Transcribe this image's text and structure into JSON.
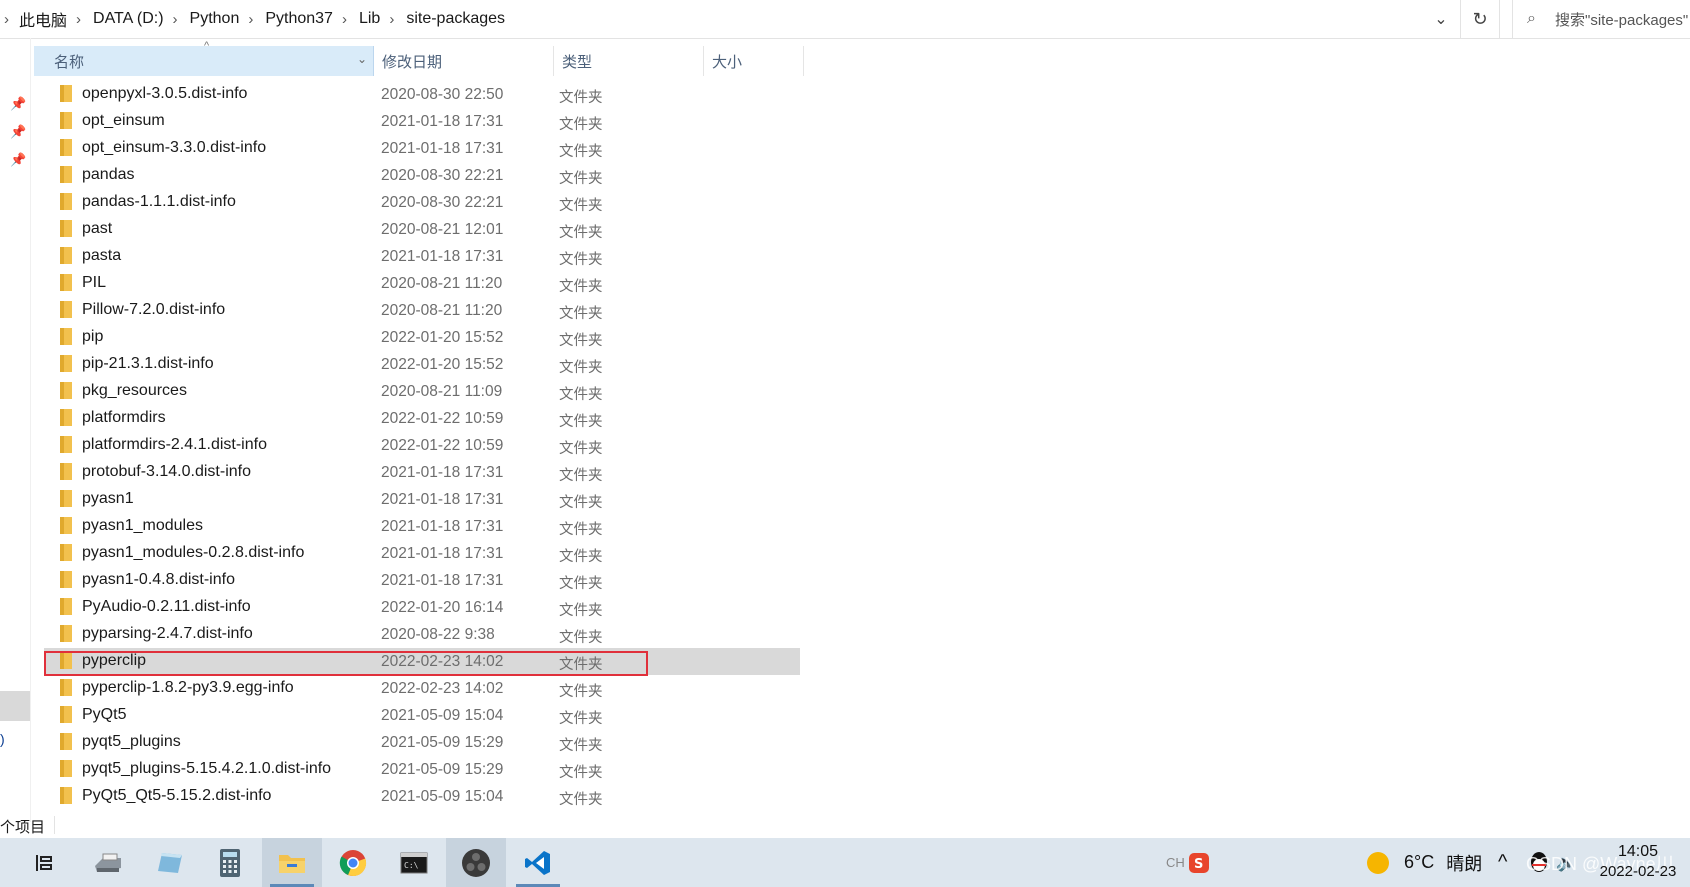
{
  "breadcrumb": {
    "items": [
      "此电脑",
      "DATA (D:)",
      "Python",
      "Python37",
      "Lib",
      "site-packages"
    ]
  },
  "search": {
    "placeholder": "搜索\"site-packages\""
  },
  "columns": {
    "name": "名称",
    "date": "修改日期",
    "type": "类型",
    "size": "大小"
  },
  "files": [
    {
      "name": "openpyxl-3.0.5.dist-info",
      "date": "2020-08-30 22:50",
      "type": "文件夹"
    },
    {
      "name": "opt_einsum",
      "date": "2021-01-18 17:31",
      "type": "文件夹"
    },
    {
      "name": "opt_einsum-3.3.0.dist-info",
      "date": "2021-01-18 17:31",
      "type": "文件夹"
    },
    {
      "name": "pandas",
      "date": "2020-08-30 22:21",
      "type": "文件夹"
    },
    {
      "name": "pandas-1.1.1.dist-info",
      "date": "2020-08-30 22:21",
      "type": "文件夹"
    },
    {
      "name": "past",
      "date": "2020-08-21 12:01",
      "type": "文件夹"
    },
    {
      "name": "pasta",
      "date": "2021-01-18 17:31",
      "type": "文件夹"
    },
    {
      "name": "PIL",
      "date": "2020-08-21 11:20",
      "type": "文件夹"
    },
    {
      "name": "Pillow-7.2.0.dist-info",
      "date": "2020-08-21 11:20",
      "type": "文件夹"
    },
    {
      "name": "pip",
      "date": "2022-01-20 15:52",
      "type": "文件夹"
    },
    {
      "name": "pip-21.3.1.dist-info",
      "date": "2022-01-20 15:52",
      "type": "文件夹"
    },
    {
      "name": "pkg_resources",
      "date": "2020-08-21 11:09",
      "type": "文件夹"
    },
    {
      "name": "platformdirs",
      "date": "2022-01-22 10:59",
      "type": "文件夹"
    },
    {
      "name": "platformdirs-2.4.1.dist-info",
      "date": "2022-01-22 10:59",
      "type": "文件夹"
    },
    {
      "name": "protobuf-3.14.0.dist-info",
      "date": "2021-01-18 17:31",
      "type": "文件夹"
    },
    {
      "name": "pyasn1",
      "date": "2021-01-18 17:31",
      "type": "文件夹"
    },
    {
      "name": "pyasn1_modules",
      "date": "2021-01-18 17:31",
      "type": "文件夹"
    },
    {
      "name": "pyasn1_modules-0.2.8.dist-info",
      "date": "2021-01-18 17:31",
      "type": "文件夹"
    },
    {
      "name": "pyasn1-0.4.8.dist-info",
      "date": "2021-01-18 17:31",
      "type": "文件夹"
    },
    {
      "name": "PyAudio-0.2.11.dist-info",
      "date": "2022-01-20 16:14",
      "type": "文件夹"
    },
    {
      "name": "pyparsing-2.4.7.dist-info",
      "date": "2020-08-22 9:38",
      "type": "文件夹"
    },
    {
      "name": "pyperclip",
      "date": "2022-02-23 14:02",
      "type": "文件夹",
      "selected": true
    },
    {
      "name": "pyperclip-1.8.2-py3.9.egg-info",
      "date": "2022-02-23 14:02",
      "type": "文件夹"
    },
    {
      "name": "PyQt5",
      "date": "2021-05-09 15:04",
      "type": "文件夹"
    },
    {
      "name": "pyqt5_plugins",
      "date": "2021-05-09 15:29",
      "type": "文件夹"
    },
    {
      "name": "pyqt5_plugins-5.15.4.2.1.0.dist-info",
      "date": "2021-05-09 15:29",
      "type": "文件夹"
    },
    {
      "name": "PyQt5_Qt5-5.15.2.dist-info",
      "date": "2021-05-09 15:04",
      "type": "文件夹"
    }
  ],
  "status": {
    "count": "个项目"
  },
  "taskbar": {
    "items": [
      {
        "icon": "task-view-icon"
      },
      {
        "icon": "printer-app-icon"
      },
      {
        "icon": "notes-app-icon"
      },
      {
        "icon": "calculator-icon"
      },
      {
        "icon": "file-explorer-icon",
        "active": true
      },
      {
        "icon": "chrome-icon"
      },
      {
        "icon": "terminal-icon"
      },
      {
        "icon": "obs-icon",
        "active": true
      },
      {
        "icon": "vscode-icon"
      }
    ],
    "ime": "CH",
    "weather": {
      "temp": "6°C",
      "condition": "晴朗"
    },
    "clock": {
      "time": "14:05",
      "date": "2022-02-23"
    },
    "watermark": "CSDN @Wayne川"
  },
  "colors": {
    "folder": "#f2c14e",
    "selection": "#d9d9d9",
    "highlight_box": "#e0303b",
    "header_active": "#d9ebf9",
    "taskbar": "#dde6ee"
  }
}
